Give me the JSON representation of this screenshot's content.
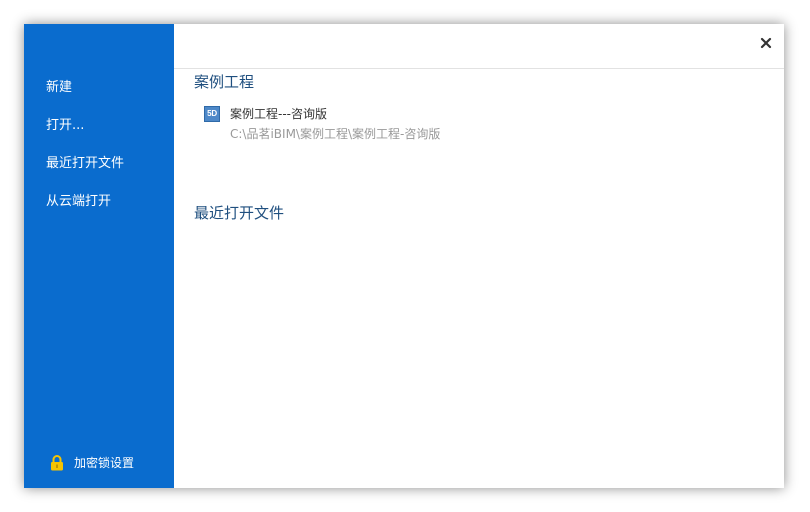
{
  "sidebar": {
    "items": [
      {
        "label": "新建"
      },
      {
        "label": "打开..."
      },
      {
        "label": "最近打开文件"
      },
      {
        "label": "从云端打开"
      }
    ],
    "footer": {
      "label": "加密锁设置",
      "icon": "lock-icon"
    }
  },
  "main": {
    "close_glyph": "×",
    "sample_section": {
      "title": "案例工程",
      "items": [
        {
          "icon_text": "5D",
          "name": "案例工程---咨询版",
          "path": "C:\\品茗iBIM\\案例工程\\案例工程-咨询版"
        }
      ]
    },
    "recent_section": {
      "title": "最近打开文件"
    }
  },
  "colors": {
    "sidebar_bg": "#0a6cce",
    "section_title": "#1f4f7f",
    "path_text": "#999999"
  }
}
